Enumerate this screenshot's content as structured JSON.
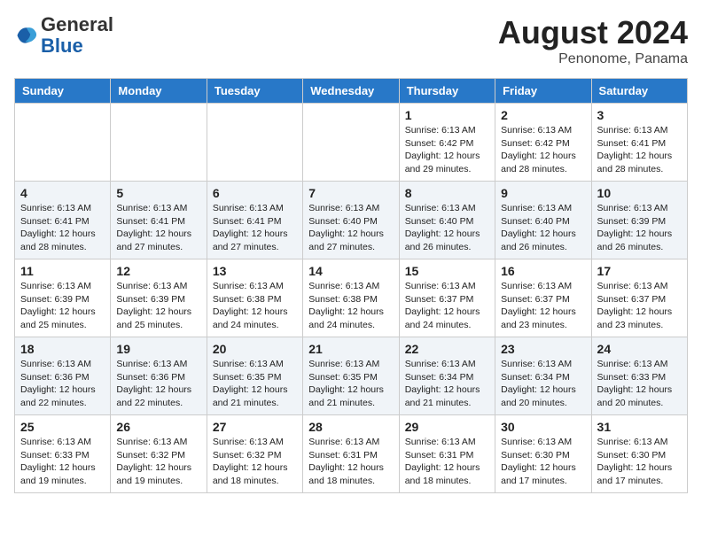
{
  "header": {
    "logo_general": "General",
    "logo_blue": "Blue",
    "month_year": "August 2024",
    "location": "Penonome, Panama"
  },
  "days_of_week": [
    "Sunday",
    "Monday",
    "Tuesday",
    "Wednesday",
    "Thursday",
    "Friday",
    "Saturday"
  ],
  "weeks": [
    [
      {
        "day": "",
        "info": ""
      },
      {
        "day": "",
        "info": ""
      },
      {
        "day": "",
        "info": ""
      },
      {
        "day": "",
        "info": ""
      },
      {
        "day": "1",
        "info": "Sunrise: 6:13 AM\nSunset: 6:42 PM\nDaylight: 12 hours\nand 29 minutes."
      },
      {
        "day": "2",
        "info": "Sunrise: 6:13 AM\nSunset: 6:42 PM\nDaylight: 12 hours\nand 28 minutes."
      },
      {
        "day": "3",
        "info": "Sunrise: 6:13 AM\nSunset: 6:41 PM\nDaylight: 12 hours\nand 28 minutes."
      }
    ],
    [
      {
        "day": "4",
        "info": "Sunrise: 6:13 AM\nSunset: 6:41 PM\nDaylight: 12 hours\nand 28 minutes."
      },
      {
        "day": "5",
        "info": "Sunrise: 6:13 AM\nSunset: 6:41 PM\nDaylight: 12 hours\nand 27 minutes."
      },
      {
        "day": "6",
        "info": "Sunrise: 6:13 AM\nSunset: 6:41 PM\nDaylight: 12 hours\nand 27 minutes."
      },
      {
        "day": "7",
        "info": "Sunrise: 6:13 AM\nSunset: 6:40 PM\nDaylight: 12 hours\nand 27 minutes."
      },
      {
        "day": "8",
        "info": "Sunrise: 6:13 AM\nSunset: 6:40 PM\nDaylight: 12 hours\nand 26 minutes."
      },
      {
        "day": "9",
        "info": "Sunrise: 6:13 AM\nSunset: 6:40 PM\nDaylight: 12 hours\nand 26 minutes."
      },
      {
        "day": "10",
        "info": "Sunrise: 6:13 AM\nSunset: 6:39 PM\nDaylight: 12 hours\nand 26 minutes."
      }
    ],
    [
      {
        "day": "11",
        "info": "Sunrise: 6:13 AM\nSunset: 6:39 PM\nDaylight: 12 hours\nand 25 minutes."
      },
      {
        "day": "12",
        "info": "Sunrise: 6:13 AM\nSunset: 6:39 PM\nDaylight: 12 hours\nand 25 minutes."
      },
      {
        "day": "13",
        "info": "Sunrise: 6:13 AM\nSunset: 6:38 PM\nDaylight: 12 hours\nand 24 minutes."
      },
      {
        "day": "14",
        "info": "Sunrise: 6:13 AM\nSunset: 6:38 PM\nDaylight: 12 hours\nand 24 minutes."
      },
      {
        "day": "15",
        "info": "Sunrise: 6:13 AM\nSunset: 6:37 PM\nDaylight: 12 hours\nand 24 minutes."
      },
      {
        "day": "16",
        "info": "Sunrise: 6:13 AM\nSunset: 6:37 PM\nDaylight: 12 hours\nand 23 minutes."
      },
      {
        "day": "17",
        "info": "Sunrise: 6:13 AM\nSunset: 6:37 PM\nDaylight: 12 hours\nand 23 minutes."
      }
    ],
    [
      {
        "day": "18",
        "info": "Sunrise: 6:13 AM\nSunset: 6:36 PM\nDaylight: 12 hours\nand 22 minutes."
      },
      {
        "day": "19",
        "info": "Sunrise: 6:13 AM\nSunset: 6:36 PM\nDaylight: 12 hours\nand 22 minutes."
      },
      {
        "day": "20",
        "info": "Sunrise: 6:13 AM\nSunset: 6:35 PM\nDaylight: 12 hours\nand 21 minutes."
      },
      {
        "day": "21",
        "info": "Sunrise: 6:13 AM\nSunset: 6:35 PM\nDaylight: 12 hours\nand 21 minutes."
      },
      {
        "day": "22",
        "info": "Sunrise: 6:13 AM\nSunset: 6:34 PM\nDaylight: 12 hours\nand 21 minutes."
      },
      {
        "day": "23",
        "info": "Sunrise: 6:13 AM\nSunset: 6:34 PM\nDaylight: 12 hours\nand 20 minutes."
      },
      {
        "day": "24",
        "info": "Sunrise: 6:13 AM\nSunset: 6:33 PM\nDaylight: 12 hours\nand 20 minutes."
      }
    ],
    [
      {
        "day": "25",
        "info": "Sunrise: 6:13 AM\nSunset: 6:33 PM\nDaylight: 12 hours\nand 19 minutes."
      },
      {
        "day": "26",
        "info": "Sunrise: 6:13 AM\nSunset: 6:32 PM\nDaylight: 12 hours\nand 19 minutes."
      },
      {
        "day": "27",
        "info": "Sunrise: 6:13 AM\nSunset: 6:32 PM\nDaylight: 12 hours\nand 18 minutes."
      },
      {
        "day": "28",
        "info": "Sunrise: 6:13 AM\nSunset: 6:31 PM\nDaylight: 12 hours\nand 18 minutes."
      },
      {
        "day": "29",
        "info": "Sunrise: 6:13 AM\nSunset: 6:31 PM\nDaylight: 12 hours\nand 18 minutes."
      },
      {
        "day": "30",
        "info": "Sunrise: 6:13 AM\nSunset: 6:30 PM\nDaylight: 12 hours\nand 17 minutes."
      },
      {
        "day": "31",
        "info": "Sunrise: 6:13 AM\nSunset: 6:30 PM\nDaylight: 12 hours\nand 17 minutes."
      }
    ]
  ]
}
